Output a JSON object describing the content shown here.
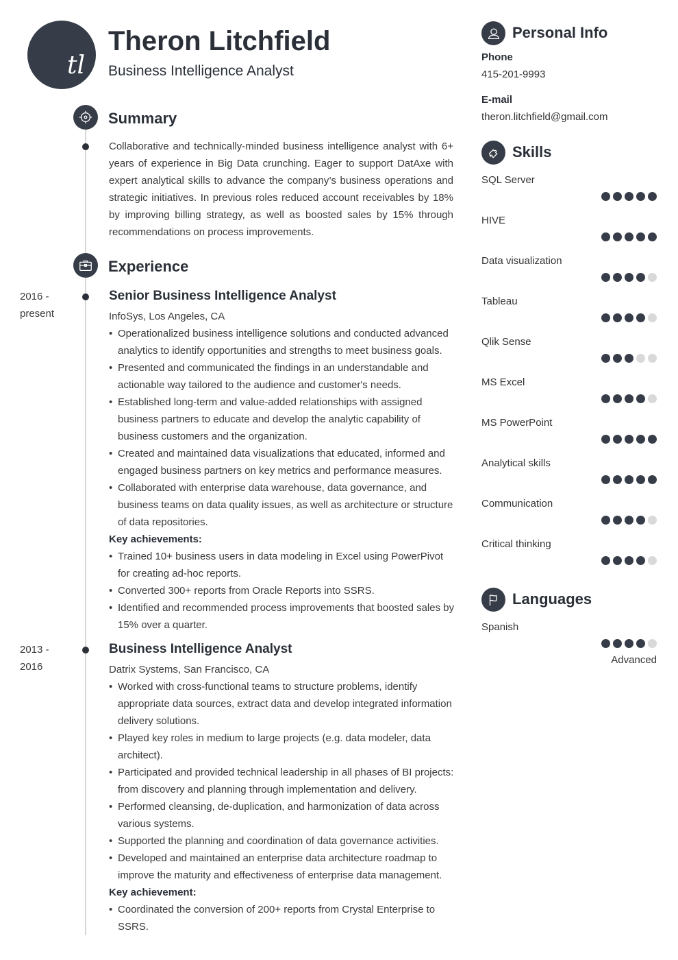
{
  "header": {
    "initials": "tl",
    "name": "Theron Litchfield",
    "title": "Business Intelligence Analyst"
  },
  "summary": {
    "heading": "Summary",
    "icon": "target-icon",
    "text": "Collaborative and technically-minded business intelligence analyst with 6+ years of experience in Big Data crunching. Eager to support DatAxe with expert analytical skills to advance the company’s business operations and strategic initiatives. In previous roles reduced account receivables by 18% by improving billing strategy, as well as boosted sales by 15% through recommendations on process improvements."
  },
  "experience": {
    "heading": "Experience",
    "icon": "briefcase-icon",
    "jobs": [
      {
        "date_start": "2016 -",
        "date_end": "present",
        "title": "Senior Business Intelligence Analyst",
        "company": "InfoSys, Los Angeles, CA",
        "bullets": [
          "Operationalized business intelligence solutions and conducted advanced analytics to identify opportunities and strengths to meet business goals.",
          "Presented and communicated the findings in an understandable and actionable way tailored to the audience and customer's needs.",
          "Established long-term and value-added relationships with assigned business partners to educate and develop the analytic capability of business customers and the organization.",
          "Created and maintained data visualizations that educated, informed and engaged business partners on key metrics and performance measures.",
          "Collaborated with enterprise data warehouse, data governance, and business teams on data quality issues, as well as architecture or structure of data repositories."
        ],
        "key_label": "Key achievements:",
        "achievements": [
          "Trained 10+ business users in data modeling in Excel using PowerPivot for creating ad-hoc reports.",
          "Converted 300+ reports from Oracle Reports into SSRS.",
          "Identified and recommended process improvements that boosted sales by 15% over a quarter."
        ]
      },
      {
        "date_start": "2013 -",
        "date_end": "2016",
        "title": "Business Intelligence Analyst",
        "company": "Datrix Systems, San Francisco, CA",
        "bullets": [
          "Worked with cross-functional teams to structure problems, identify appropriate data sources, extract data and develop integrated information delivery solutions.",
          "Played key roles in medium to large projects (e.g. data modeler, data architect).",
          "Participated and provided technical leadership in all phases of BI projects: from discovery and planning through implementation and delivery.",
          "Performed cleansing, de-duplication, and harmonization of data across various systems.",
          "Supported the planning and coordination of data governance activities.",
          "Developed and maintained an enterprise data architecture roadmap to improve the maturity and effectiveness of enterprise data management."
        ],
        "key_label": "Key achievement:",
        "achievements": [
          "Coordinated the conversion of 200+ reports from Crystal Enterprise to SSRS."
        ]
      }
    ]
  },
  "personal_info": {
    "heading": "Personal Info",
    "icon": "user-icon",
    "phone_label": "Phone",
    "phone": "415-201-9993",
    "email_label": "E-mail",
    "email": "theron.litchfield@gmail.com"
  },
  "skills": {
    "heading": "Skills",
    "icon": "puzzle-icon",
    "max_rating": 5,
    "items": [
      {
        "name": "SQL Server",
        "rating": 5
      },
      {
        "name": "HIVE",
        "rating": 5
      },
      {
        "name": "Data visualization",
        "rating": 4
      },
      {
        "name": "Tableau",
        "rating": 4
      },
      {
        "name": "Qlik Sense",
        "rating": 3
      },
      {
        "name": "MS Excel",
        "rating": 4
      },
      {
        "name": "MS PowerPoint",
        "rating": 5
      },
      {
        "name": "Analytical skills",
        "rating": 5
      },
      {
        "name": "Communication",
        "rating": 4
      },
      {
        "name": "Critical thinking",
        "rating": 4
      }
    ]
  },
  "languages": {
    "heading": "Languages",
    "icon": "flag-icon",
    "max_rating": 5,
    "items": [
      {
        "name": "Spanish",
        "rating": 4,
        "level": "Advanced"
      }
    ]
  },
  "colors": {
    "accent": "#373d48",
    "heading": "#2a2f38",
    "text": "#3a3a3a",
    "timeline": "#d6d6d6",
    "rating_off": "#d9d9d9"
  }
}
